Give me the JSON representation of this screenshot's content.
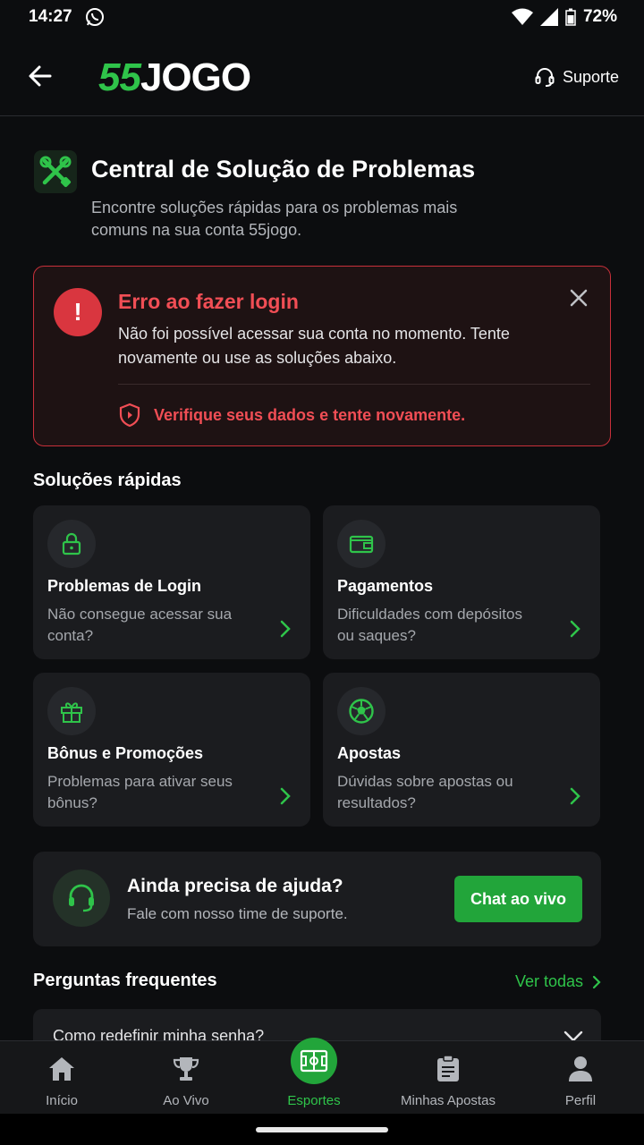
{
  "status_bar": {
    "time": "14:27",
    "battery": "72%"
  },
  "header": {
    "logo_num": "55",
    "logo_word": "JOGO",
    "support_label": "Suporte"
  },
  "page": {
    "title": "Central de Solução de Problemas",
    "subtitle": "Encontre soluções rápidas para os problemas mais comuns na sua conta 55jogo."
  },
  "error": {
    "icon": "!",
    "title": "Erro ao fazer login",
    "message": "Não foi possível acessar sua conta no momento. Tente novamente ou use as soluções abaixo.",
    "verify": "Verifique seus dados e tente novamente."
  },
  "quick": {
    "title": "Soluções rápidas",
    "cards": [
      {
        "icon": "lock-icon",
        "title": "Problemas de Login",
        "desc": "Não consegue acessar sua conta?"
      },
      {
        "icon": "wallet-icon",
        "title": "Pagamentos",
        "desc": "Dificuldades com depósitos ou saques?"
      },
      {
        "icon": "gift-icon",
        "title": "Bônus e Promoções",
        "desc": "Problemas para ativar seus bônus?"
      },
      {
        "icon": "soccer-ball-icon",
        "title": "Apostas",
        "desc": "Dúvidas sobre apostas ou resultados?"
      }
    ]
  },
  "help": {
    "title": "Ainda precisa de ajuda?",
    "desc": "Fale com nosso time de suporte.",
    "button": "Chat ao vivo"
  },
  "faq": {
    "title": "Perguntas frequentes",
    "see_all": "Ver todas",
    "items": [
      {
        "question": "Como redefinir minha senha?"
      }
    ]
  },
  "nav": {
    "items": [
      {
        "label": "Início",
        "icon": "home-icon"
      },
      {
        "label": "Ao Vivo",
        "icon": "trophy-icon"
      },
      {
        "label": "Esportes",
        "icon": "field-icon",
        "active": true
      },
      {
        "label": "Minhas Apostas",
        "icon": "clipboard-icon"
      },
      {
        "label": "Perfil",
        "icon": "user-icon"
      }
    ]
  },
  "colors": {
    "accent": "#2fc44a",
    "error": "#f14e55",
    "background": "#0c0d0f",
    "card": "#1b1c1f"
  }
}
